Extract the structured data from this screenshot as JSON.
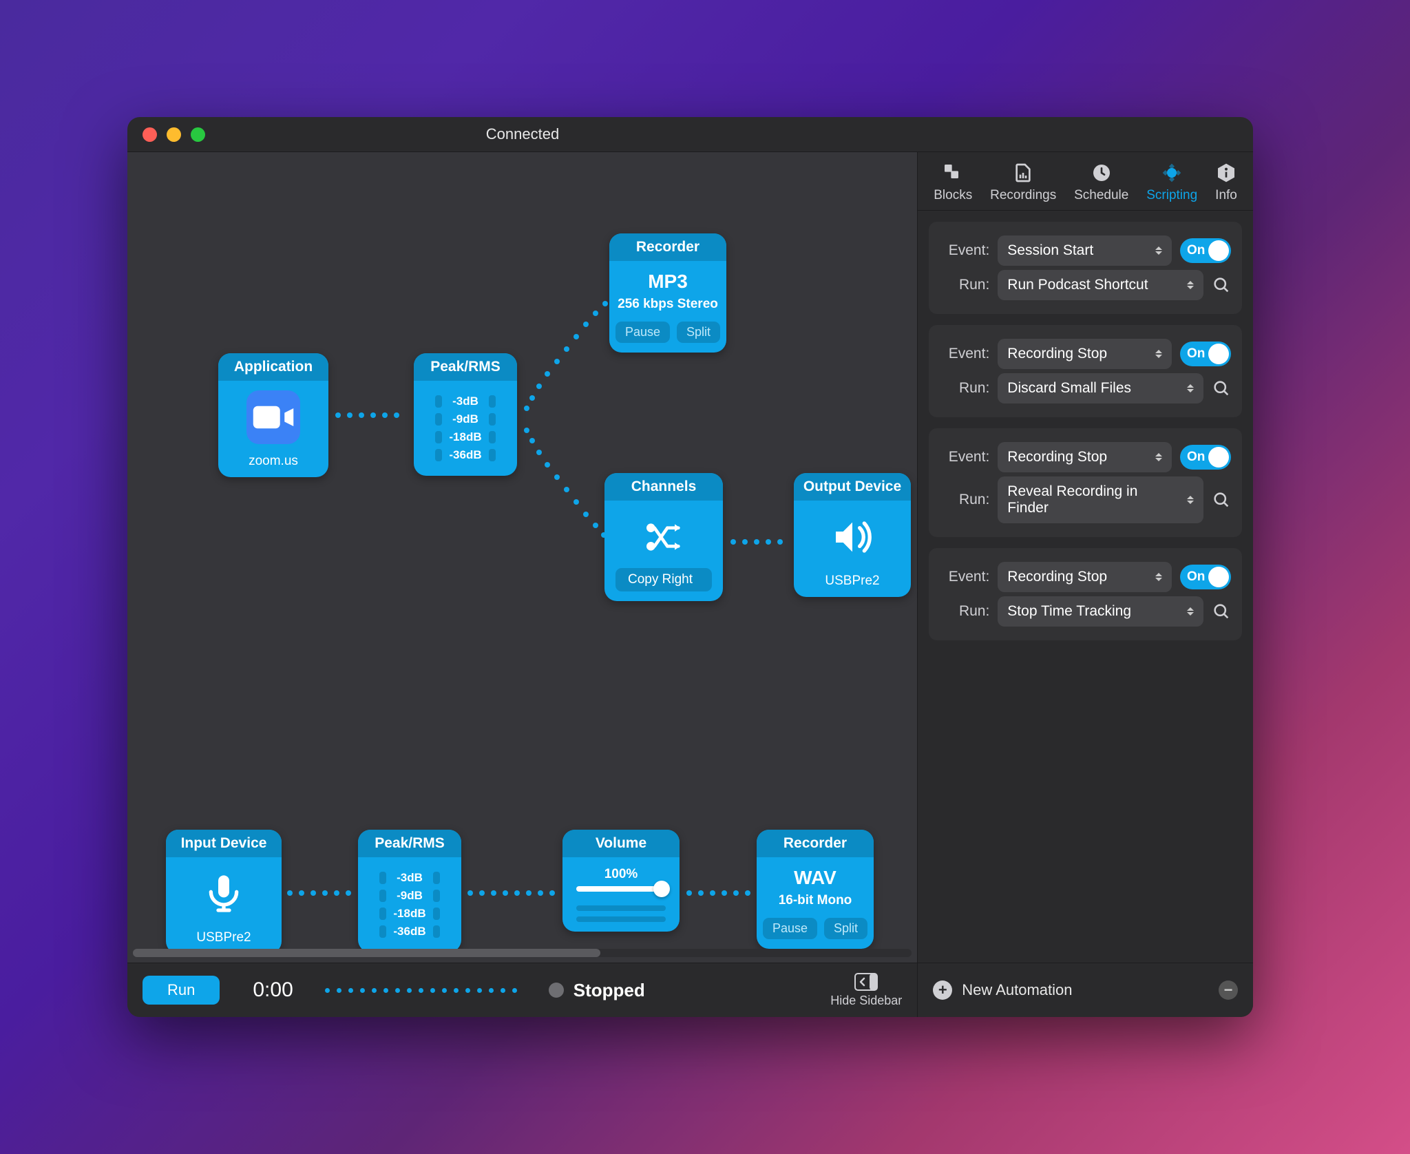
{
  "window": {
    "title": "Connected"
  },
  "sidebar": {
    "tabs": [
      "Blocks",
      "Recordings",
      "Schedule",
      "Scripting",
      "Info"
    ],
    "active_tab": "Scripting",
    "labels": {
      "event": "Event:",
      "run": "Run:",
      "on": "On"
    },
    "automations": [
      {
        "event": "Session Start",
        "run": "Run Podcast Shortcut",
        "enabled": true
      },
      {
        "event": "Recording Stop",
        "run": "Discard Small Files",
        "enabled": true
      },
      {
        "event": "Recording Stop",
        "run": "Reveal Recording in Finder",
        "enabled": true
      },
      {
        "event": "Recording Stop",
        "run": "Stop Time Tracking",
        "enabled": true
      }
    ],
    "footer": {
      "new": "New Automation"
    }
  },
  "bottombar": {
    "run": "Run",
    "time": "0:00",
    "status": "Stopped",
    "hide_sidebar": "Hide Sidebar"
  },
  "nodes": {
    "application": {
      "title": "Application",
      "footer": "zoom.us"
    },
    "peakrms": {
      "title": "Peak/RMS",
      "levels": [
        "-3dB",
        "-9dB",
        "-18dB",
        "-36dB"
      ]
    },
    "recorder_mp3": {
      "title": "Recorder",
      "format": "MP3",
      "subtitle": "256 kbps Stereo",
      "pause": "Pause",
      "split": "Split"
    },
    "channels": {
      "title": "Channels",
      "action": "Copy Right"
    },
    "output_device": {
      "title": "Output Device",
      "footer": "USBPre2"
    },
    "input_device": {
      "title": "Input Device",
      "footer": "USBPre2"
    },
    "peakrms2": {
      "title": "Peak/RMS",
      "levels": [
        "-3dB",
        "-9dB",
        "-18dB",
        "-36dB"
      ]
    },
    "volume": {
      "title": "Volume",
      "value": "100%"
    },
    "recorder_wav": {
      "title": "Recorder",
      "format": "WAV",
      "subtitle": "16-bit Mono",
      "pause": "Pause",
      "split": "Split"
    }
  }
}
